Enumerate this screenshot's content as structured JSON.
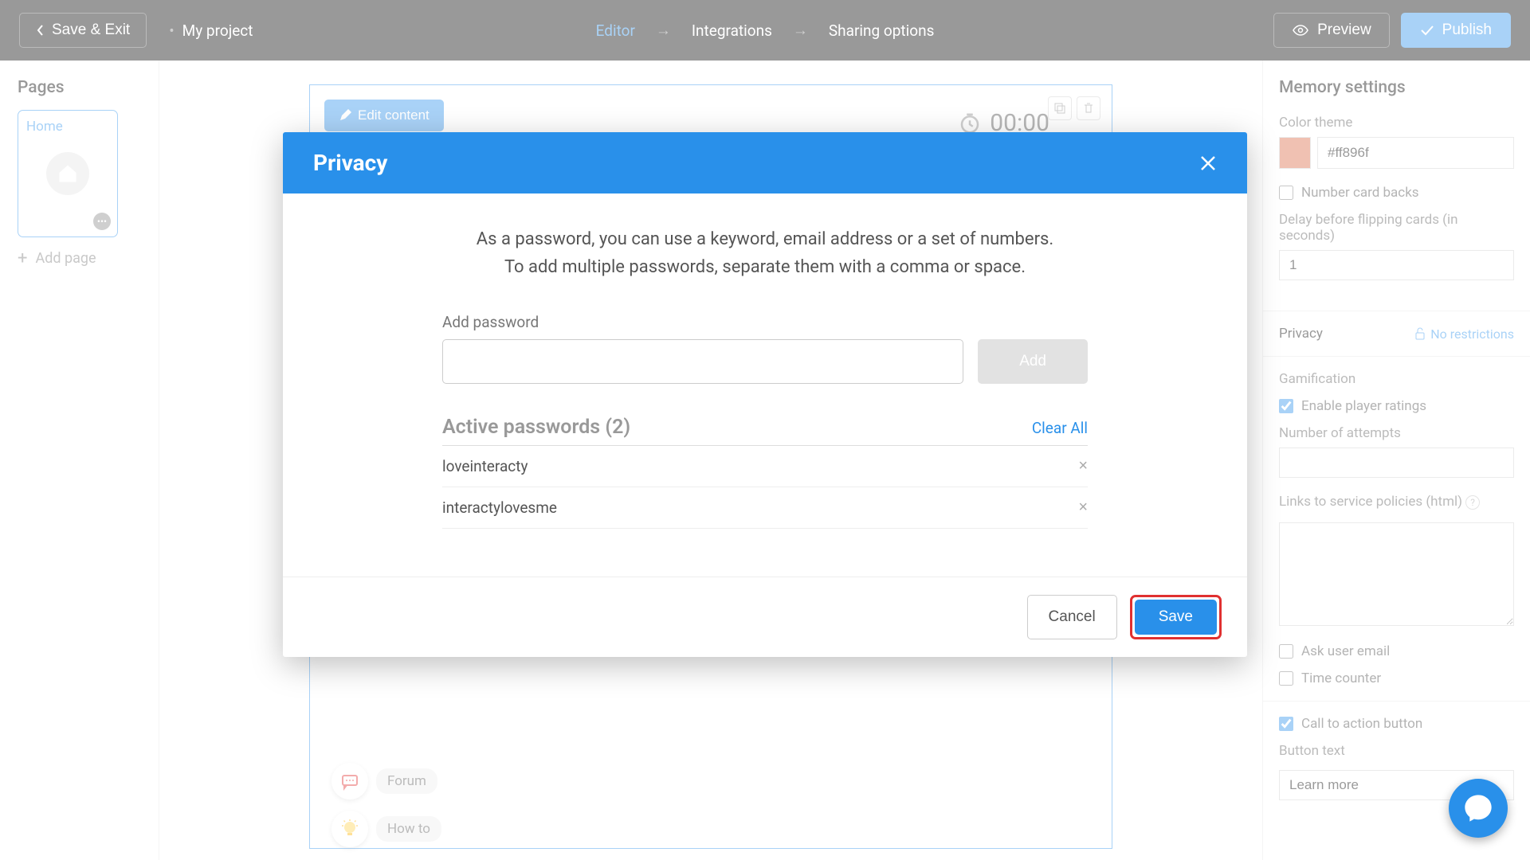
{
  "topbar": {
    "save_exit": "Save & Exit",
    "project": "My project",
    "nav": {
      "editor": "Editor",
      "integrations": "Integrations",
      "sharing": "Sharing options"
    },
    "preview": "Preview",
    "publish": "Publish"
  },
  "sidebar_left": {
    "heading": "Pages",
    "page_name": "Home",
    "add_page": "Add page"
  },
  "canvas": {
    "edit_content": "Edit content",
    "timer": "00:00"
  },
  "float": {
    "forum": "Forum",
    "howto": "How to"
  },
  "sidebar_right": {
    "heading": "Memory settings",
    "color_theme_label": "Color theme",
    "color_value": "#ff896f",
    "number_card_backs": "Number card backs",
    "delay_label": "Delay before flipping cards (in seconds)",
    "delay_value": "1",
    "privacy": "Privacy",
    "no_restrictions": "No restrictions",
    "gamification": "Gamification",
    "enable_ratings": "Enable player ratings",
    "attempts_label": "Number of attempts",
    "policies_label": "Links to service policies (html)",
    "ask_email": "Ask user email",
    "time_counter": "Time counter",
    "cta": "Call to action button",
    "button_text_label": "Button text",
    "button_text_value": "Learn more"
  },
  "modal": {
    "title": "Privacy",
    "desc1": "As a password, you can use a keyword, email address or a set of numbers.",
    "desc2": "To add multiple passwords, separate them with a comma or space.",
    "add_label": "Add password",
    "add_btn": "Add",
    "active_label": "Active passwords",
    "active_count": "(2)",
    "clear_all": "Clear All",
    "passwords": [
      "loveinteracty",
      "interactylovesme"
    ],
    "cancel": "Cancel",
    "save": "Save"
  }
}
